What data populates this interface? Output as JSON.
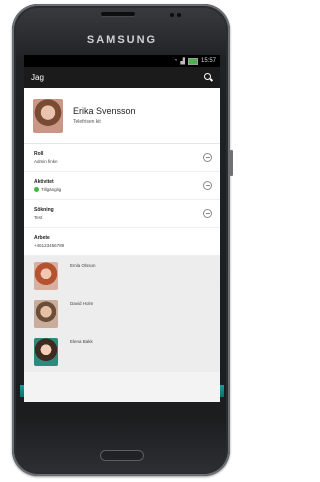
{
  "device": {
    "brand": "SAMSUNG"
  },
  "status_bar": {
    "time": "15:57"
  },
  "app_bar": {
    "title": "Jag",
    "search_icon": "search-icon"
  },
  "profile": {
    "name": "Erika Svensson",
    "title": "Telefrisen kit"
  },
  "fields": [
    {
      "label": "Roll",
      "value": "Admin finkn"
    },
    {
      "label": "Aktivitet",
      "value": "Tillgänglig",
      "status_color": "#3dbb3d"
    },
    {
      "label": "Sökning",
      "value": "Test"
    },
    {
      "label": "Arbete",
      "value": "+46123456789"
    }
  ],
  "contacts": [
    {
      "name": "Emla Olsson"
    },
    {
      "name": "David Holm"
    },
    {
      "name": "Elena Bakk"
    }
  ],
  "colors": {
    "accent": "#1a9b9b",
    "status_available": "#3dbb3d"
  }
}
